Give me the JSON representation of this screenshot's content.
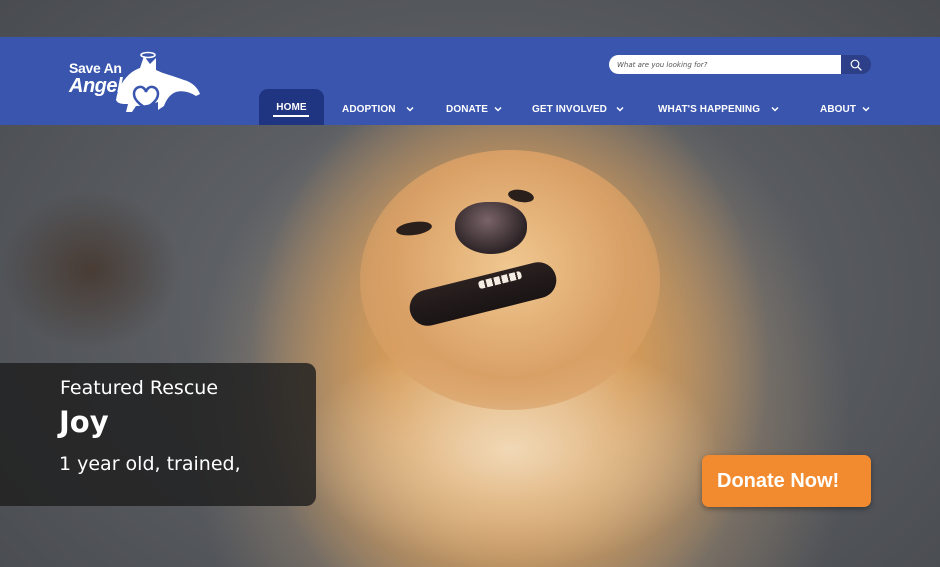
{
  "logo": {
    "line1": "Save An",
    "line2": "Angel"
  },
  "search": {
    "placeholder": "What are you looking for?"
  },
  "nav": {
    "items": [
      {
        "label": "HOME"
      },
      {
        "label": "ADOPTION"
      },
      {
        "label": "DONATE"
      },
      {
        "label": "GET INVOLVED"
      },
      {
        "label": "WHAT'S HAPPENING"
      },
      {
        "label": "ABOUT"
      }
    ]
  },
  "featured": {
    "label": "Featured Rescue",
    "name": "Joy",
    "description": "1 year old, trained,"
  },
  "cta": {
    "donate_label": "Donate Now!"
  },
  "colors": {
    "header": "#3a55ae",
    "nav_active": "#1f3582",
    "donate": "#f28b2f"
  }
}
